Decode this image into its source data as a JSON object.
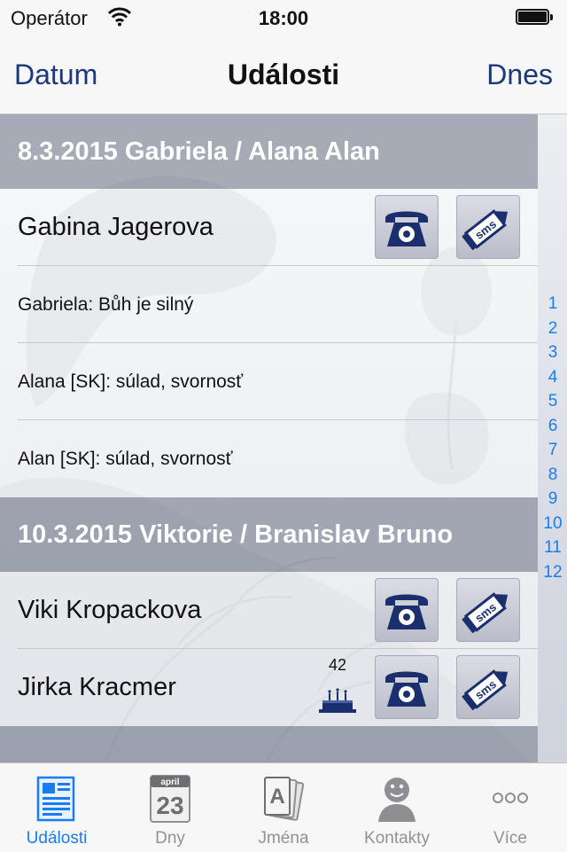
{
  "status": {
    "carrier": "Operátor",
    "time": "18:00"
  },
  "nav": {
    "left": "Datum",
    "title": "Události",
    "right": "Dnes"
  },
  "sections": [
    {
      "header": "8.3.2015 Gabriela / Alana Alan",
      "contact": "Gabina Jagerova",
      "info": [
        "Gabriela: Bůh je silný",
        "Alana [SK]: súlad, svornosť",
        "Alan [SK]: súlad, svornosť"
      ]
    },
    {
      "header": "10.3.2015 Viktorie / Branislav Bruno",
      "contacts": [
        {
          "name": "Viki Kropackova"
        },
        {
          "name": "Jirka Kracmer",
          "age": "42"
        }
      ]
    }
  ],
  "sms_label": "sms",
  "index": [
    "1",
    "2",
    "3",
    "4",
    "5",
    "6",
    "7",
    "8",
    "9",
    "10",
    "11",
    "12"
  ],
  "tabs": [
    {
      "label": "Události",
      "icon": "news-icon"
    },
    {
      "label": "Dny",
      "icon": "calendar-icon",
      "month": "april",
      "day": "23"
    },
    {
      "label": "Jména",
      "icon": "name-cards-icon",
      "letter": "A"
    },
    {
      "label": "Kontakty",
      "icon": "person-icon"
    },
    {
      "label": "Více",
      "icon": "more-icon"
    }
  ],
  "colors": {
    "accent": "#1a7cf0",
    "nav_text": "#1b3878",
    "icon_navy": "#1b2f6e"
  }
}
